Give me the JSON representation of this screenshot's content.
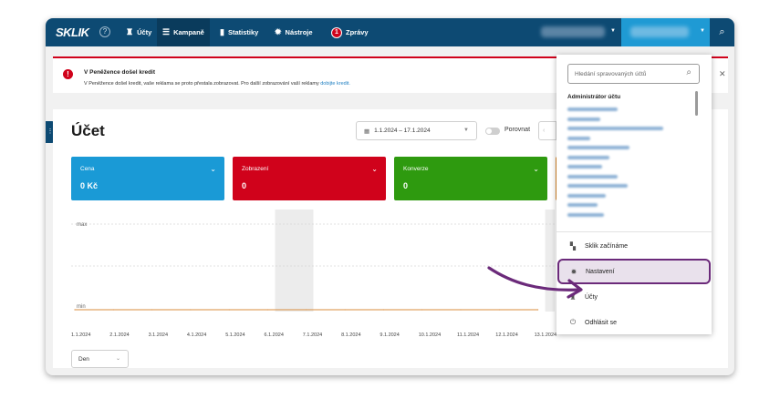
{
  "nav": {
    "logo": "SKLIK",
    "items": [
      {
        "label": "Účty",
        "icon": "accounts-icon"
      },
      {
        "label": "Kampaně",
        "icon": "menu-icon"
      },
      {
        "label": "Statistiky",
        "icon": "bar-chart-icon"
      },
      {
        "label": "Nástroje",
        "icon": "gear-icon"
      },
      {
        "label": "Zprávy",
        "icon": "messages-badge-icon",
        "badge": "1"
      }
    ]
  },
  "alert": {
    "title": "V Peněžence došel kredit",
    "text": "V Peněžence došel kredit, vaše reklama se proto přestala zobrazovat. Pro další zobrazování vaší reklamy",
    "link": "dobijte kredit."
  },
  "page": {
    "title": "Účet",
    "date_range": "1.1.2024 – 17.1.2024",
    "compare_label": "Porovnat",
    "period": "Den"
  },
  "metrics": [
    {
      "label": "Cena",
      "value": "0 Kč",
      "color": "#1a9ad6"
    },
    {
      "label": "Zobrazení",
      "value": "0",
      "color": "#d0021b"
    },
    {
      "label": "Konverze",
      "value": "0",
      "color": "#2e9a0f"
    }
  ],
  "chart_data": {
    "type": "line",
    "y_labels": [
      "max",
      "min"
    ],
    "x": [
      "1.1.2024",
      "2.1.2024",
      "3.1.2024",
      "4.1.2024",
      "5.1.2024",
      "6.1.2024",
      "7.1.2024",
      "8.1.2024",
      "9.1.2024",
      "10.1.2024",
      "11.1.2024",
      "12.1.2024",
      "13.1.2024"
    ],
    "series": [
      {
        "values": [
          0,
          0,
          0,
          0,
          0,
          0,
          0,
          0,
          0,
          0,
          0,
          0,
          0
        ],
        "color": "#d98c3e"
      }
    ],
    "grid": true
  },
  "dropdown": {
    "search_placeholder": "Hledání spravovaných účtů",
    "heading": "Administrátor účtu",
    "menu": [
      {
        "label": "Sklik začínáme",
        "icon": "dashboard-icon"
      },
      {
        "label": "Nastavení",
        "icon": "settings-gear-icon"
      },
      {
        "label": "Účty",
        "icon": "accounts-icon"
      },
      {
        "label": "Odhlásit se",
        "icon": "power-icon"
      }
    ]
  },
  "colors": {
    "nav_bg": "#0d4a73",
    "highlight_border": "#6b2a7a",
    "arrow": "#6b2a7a"
  }
}
